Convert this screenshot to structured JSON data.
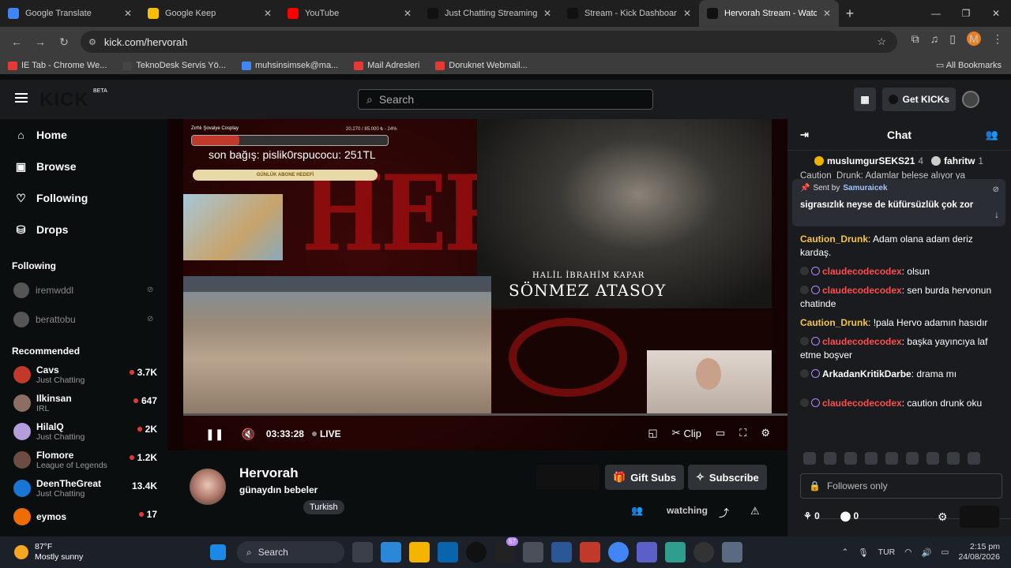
{
  "browser": {
    "tabs": [
      {
        "title": "Google Translate",
        "color": "#4285f4",
        "active": false
      },
      {
        "title": "Google Keep",
        "color": "#fbbc04",
        "active": false
      },
      {
        "title": "YouTube",
        "color": "#ff0000",
        "active": false
      },
      {
        "title": "Just Chatting Streaming - ",
        "color": "#111111",
        "active": false
      },
      {
        "title": "Stream - Kick Dashboard",
        "color": "#111111",
        "active": false
      },
      {
        "title": "Hervorah Stream - Watch",
        "color": "#111111",
        "active": true
      }
    ],
    "url": "kick.com/hervorah",
    "profile_initial": "M",
    "bookmarks": [
      {
        "label": "IE Tab - Chrome We...",
        "color": "#e53935"
      },
      {
        "label": "TeknoDesk Servis Yö...",
        "color": "#444444"
      },
      {
        "label": "muhsinsimsek@ma...",
        "color": "#4285f4"
      },
      {
        "label": "Mail Adresleri",
        "color": "#e53935"
      },
      {
        "label": "Doruknet Webmail...",
        "color": "#e53935"
      }
    ],
    "all_bookmarks": "All Bookmarks"
  },
  "kick": {
    "logo": "KICK",
    "beta": "BETA",
    "search_placeholder": "Search",
    "get_kicks": "Get KICKs"
  },
  "sidebar": {
    "nav": [
      {
        "label": "Home",
        "icon": "home-icon",
        "glyph": "⌂"
      },
      {
        "label": "Browse",
        "icon": "browse-icon",
        "glyph": "▣"
      },
      {
        "label": "Following",
        "icon": "heart-icon",
        "glyph": "♡"
      },
      {
        "label": "Drops",
        "icon": "drops-icon",
        "glyph": "⛁"
      }
    ],
    "following_title": "Following",
    "following": [
      "iremwddl",
      "berattobu"
    ],
    "recommended_title": "Recommended",
    "recommended": [
      {
        "name": "Cavs",
        "category": "Just Chatting",
        "viewers": "3.7K",
        "color": "#c0392b"
      },
      {
        "name": "Ilkinsan",
        "category": "IRL",
        "viewers": "647",
        "color": "#8d6e63"
      },
      {
        "name": "HilalQ",
        "category": "Just Chatting",
        "viewers": "2K",
        "color": "#b39ddb"
      },
      {
        "name": "Flomore",
        "category": "League of Legends",
        "viewers": "1.2K",
        "color": "#6d4c41"
      },
      {
        "name": "DeenTheGreat",
        "category": "Just Chatting",
        "viewers": "13.4K",
        "color": "#1976d2"
      },
      {
        "name": "eymos",
        "category": "",
        "viewers": "17",
        "color": "#ef6c00"
      }
    ]
  },
  "overlay": {
    "goal_label": "Zırhlı Şovalye Cosplay",
    "goal_count": "20.270 / 85.000 ₺ - 24%",
    "goal_progress": 0.24,
    "last_sub": "son bağış: pislik0rspucocu: 251TL",
    "daily_goal": "GÜNLÜK ABONE HEDEFİ",
    "watermark": "HERV",
    "actor_role": "HALİL İBRAHİM KAPAR",
    "actor_name": "SÖNMEZ ATASOY"
  },
  "player": {
    "time": "03:33:28",
    "live": "LIVE",
    "clip": "Clip"
  },
  "stream": {
    "name": "Hervorah",
    "title": "günaydın bebeler",
    "tag": "Turkish",
    "gift_subs": "Gift Subs",
    "subscribe": "Subscribe",
    "watching": "watching"
  },
  "chat": {
    "title": "Chat",
    "gifters": [
      {
        "name": "muslumgurSEKS21",
        "count": "4"
      },
      {
        "name": "fahritw",
        "count": "1"
      }
    ],
    "overflow_line": "Caution_Drunk: Adamlar belese alıyor ya",
    "pinned": {
      "sent_by": "Sent by",
      "user": "Samuraicek",
      "message": "sigrasızlık neyse de küfürsüzlük çok zor"
    },
    "messages": [
      {
        "user": "Caution_Drunk",
        "color": "#f5c542",
        "badge": false,
        "text": "Adam olana adam deriz kardaş."
      },
      {
        "user": "claudecodecodex",
        "color": "#ff4d4d",
        "badge": true,
        "text": "olsun"
      },
      {
        "user": "claudecodecodex",
        "color": "#ff4d4d",
        "badge": true,
        "text": "sen burda hervonun chatinde"
      },
      {
        "user": "Caution_Drunk",
        "color": "#f5c542",
        "badge": false,
        "text": "!pala Hervo adamın hasıdır"
      },
      {
        "user": "claudecodecodex",
        "color": "#ff4d4d",
        "badge": true,
        "text": "başka yayıncıya laf etme boşver"
      },
      {
        "user": "ArkadanKritikDarbe",
        "color": "#ffffff",
        "badge": true,
        "text": "drama mı"
      },
      {
        "user": "claudecodecodex",
        "color": "#ff4d4d",
        "badge": true,
        "text": "caution drunk oku"
      }
    ],
    "followers_only": "Followers only",
    "kicks_count": "0",
    "points_count": "0"
  },
  "taskbar": {
    "temperature": "87°F",
    "condition": "Mostly sunny",
    "search": "Search",
    "language": "TUR",
    "time": "2:15 pm",
    "date": "24/08/2026",
    "badge_count": "57"
  }
}
